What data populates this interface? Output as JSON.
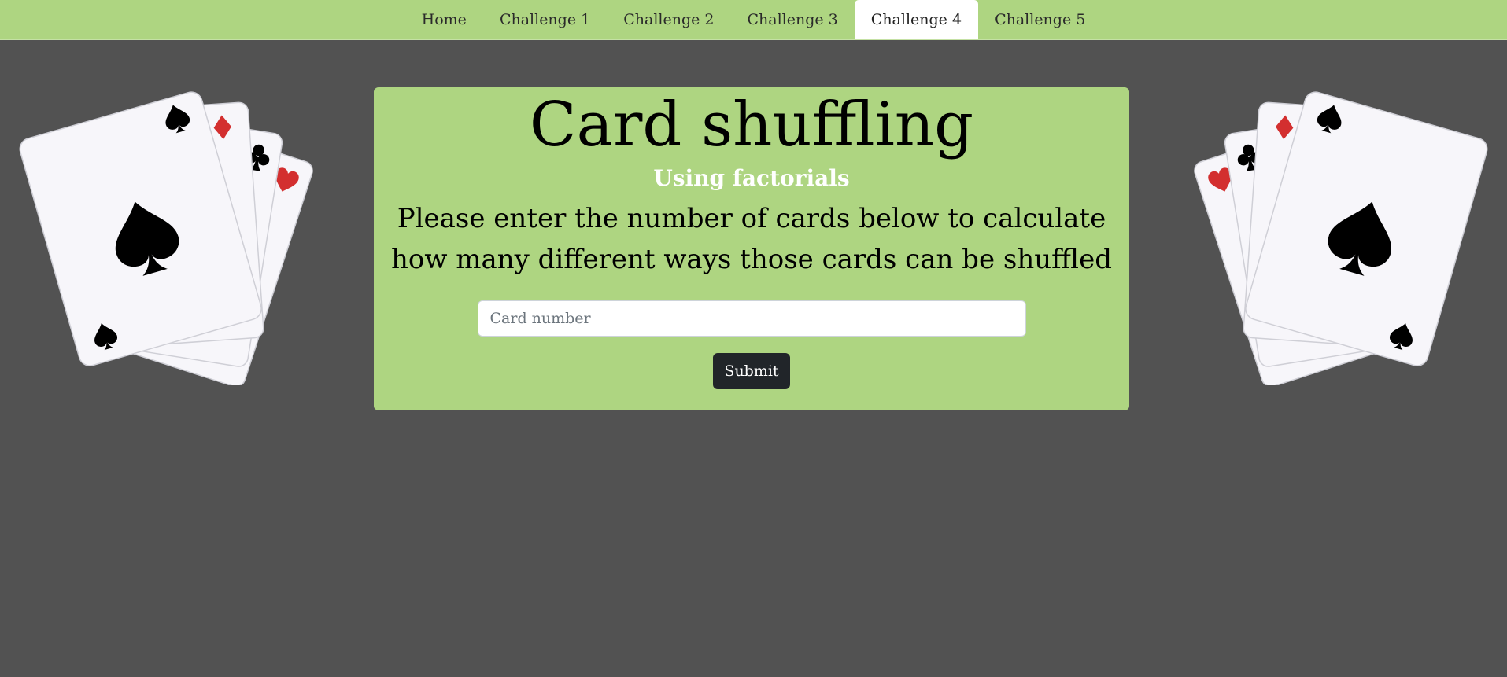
{
  "nav": {
    "items": [
      {
        "label": "Home",
        "active": false
      },
      {
        "label": "Challenge 1",
        "active": false
      },
      {
        "label": "Challenge 2",
        "active": false
      },
      {
        "label": "Challenge 3",
        "active": false
      },
      {
        "label": "Challenge 4",
        "active": true
      },
      {
        "label": "Challenge 5",
        "active": false
      }
    ]
  },
  "main": {
    "title": "Card shuffling",
    "subtitle": "Using factorials",
    "prompt": "Please enter the number of cards below to calculate how many different ways those cards can be shuffled",
    "input_placeholder": "Card number",
    "input_value": "",
    "submit_label": "Submit"
  },
  "decorations": {
    "left_fan": [
      "spade",
      "diamond",
      "club",
      "heart"
    ],
    "right_fan": [
      "heart",
      "club",
      "diamond",
      "spade"
    ]
  },
  "colors": {
    "background": "#525252",
    "accent": "#aed581",
    "button": "#212529",
    "suit_red": "#d32f2f",
    "suit_black": "#000000"
  }
}
